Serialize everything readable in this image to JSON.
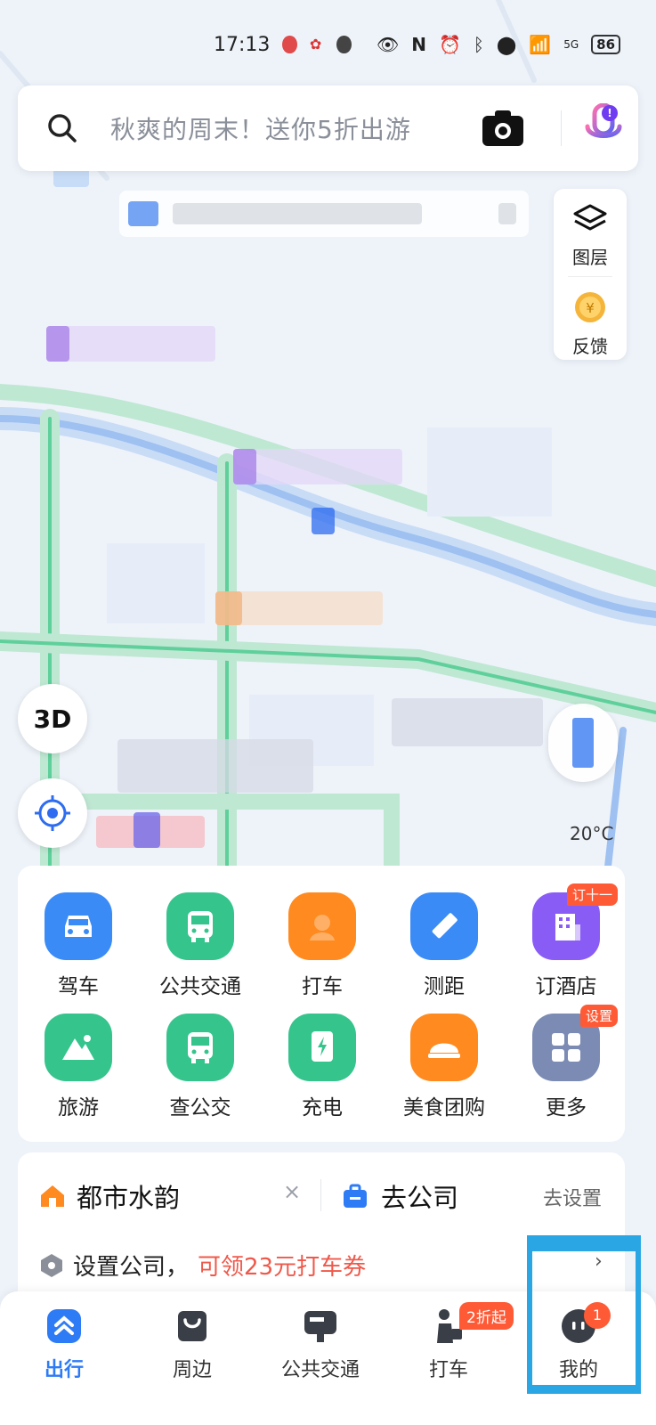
{
  "status_bar": {
    "time": "17:13",
    "network": "5G",
    "battery": "86"
  },
  "search": {
    "placeholder": "秋爽的周末！送你5折出游"
  },
  "side_panel": {
    "layers_label": "图层",
    "feedback_label": "反馈"
  },
  "map_controls": {
    "three_d_label": "3D",
    "temperature": "20°C"
  },
  "quick_grid": [
    {
      "id": "drive",
      "label": "驾车",
      "color": "#3b8bf7",
      "icon": "car-icon"
    },
    {
      "id": "transit",
      "label": "公共交通",
      "color": "#35c48c",
      "icon": "bus-icon"
    },
    {
      "id": "taxi",
      "label": "打车",
      "color": "#ff8a1f",
      "icon": "taxi-icon"
    },
    {
      "id": "measure",
      "label": "测距",
      "color": "#3b8bf7",
      "icon": "ruler-icon"
    },
    {
      "id": "hotel",
      "label": "订酒店",
      "color": "#8a5cf6",
      "icon": "hotel-icon",
      "badge": "订十一"
    },
    {
      "id": "travel",
      "label": "旅游",
      "color": "#35c48c",
      "icon": "mountain-icon"
    },
    {
      "id": "bus",
      "label": "查公交",
      "color": "#35c48c",
      "icon": "bus-icon"
    },
    {
      "id": "charge",
      "label": "充电",
      "color": "#35c48c",
      "icon": "charger-icon"
    },
    {
      "id": "food",
      "label": "美食团购",
      "color": "#ff8a1f",
      "icon": "food-icon"
    },
    {
      "id": "more",
      "label": "更多",
      "color": "#7b8bb3",
      "icon": "grid-icon",
      "badge": "设置"
    }
  ],
  "commute": {
    "home_name": "都市水韵",
    "close_symbol": "×",
    "work_name": "去公司",
    "set_link": "去设置",
    "set_company_prefix": "设置公司，",
    "set_company_promo": "可领23元打车券",
    "chevron": "›"
  },
  "tabbar": {
    "tabs": [
      {
        "label": "出行",
        "icon": "travel-tab-icon",
        "active": true
      },
      {
        "label": "周边",
        "icon": "bag-icon"
      },
      {
        "label": "公共交通",
        "icon": "transit-tab-icon"
      },
      {
        "label": "打车",
        "icon": "rider-icon",
        "badge": "2折起"
      },
      {
        "label": "我的",
        "icon": "profile-icon",
        "badge": "1"
      }
    ]
  }
}
